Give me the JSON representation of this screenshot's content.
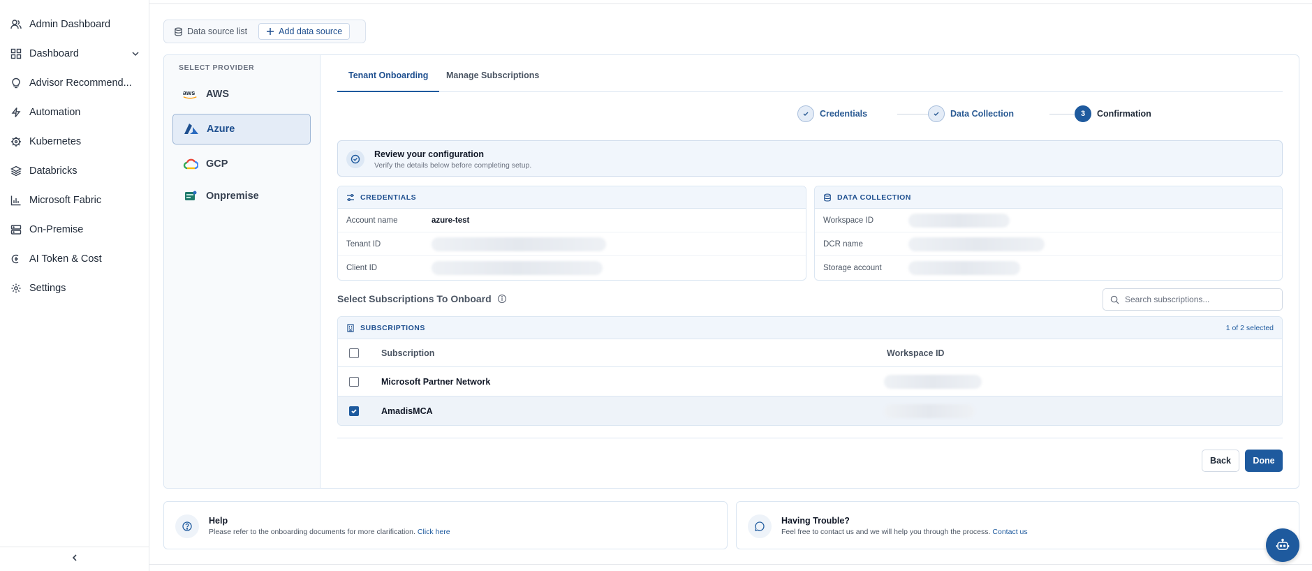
{
  "sidebar": {
    "items": [
      {
        "label": "Admin Dashboard",
        "icon": "user-icon"
      },
      {
        "label": "Dashboard",
        "icon": "grid-icon"
      },
      {
        "label": "Advisor Recommend...",
        "icon": "lightbulb-icon"
      },
      {
        "label": "Automation",
        "icon": "bolt-icon"
      },
      {
        "label": "Kubernetes",
        "icon": "helm-icon"
      },
      {
        "label": "Databricks",
        "icon": "layers-icon"
      },
      {
        "label": "Microsoft Fabric",
        "icon": "bar-chart-icon"
      },
      {
        "label": "On-Premise",
        "icon": "server-icon"
      },
      {
        "label": "AI Token & Cost",
        "icon": "token-icon"
      },
      {
        "label": "Settings",
        "icon": "gear-icon"
      }
    ]
  },
  "toggle": {
    "list_label": "Data source list",
    "add_label": "Add data source"
  },
  "providers": {
    "title": "SELECT PROVIDER",
    "items": [
      {
        "label": "AWS",
        "logo_text": "aws"
      },
      {
        "label": "Azure"
      },
      {
        "label": "GCP"
      },
      {
        "label": "Onpremise"
      }
    ],
    "active": "Azure"
  },
  "tabs": {
    "onboarding": "Tenant Onboarding",
    "manage": "Manage Subscriptions"
  },
  "stepper": {
    "step1": "Credentials",
    "step2": "Data Collection",
    "step3_num": "3",
    "step3": "Confirmation"
  },
  "review": {
    "title": "Review your configuration",
    "subtitle": "Verify the details below before completing setup."
  },
  "credentials": {
    "title": "CREDENTIALS",
    "account_label": "Account name",
    "account_value": "azure-test",
    "tenant_label": "Tenant ID",
    "client_label": "Client ID"
  },
  "data_collection": {
    "title": "DATA COLLECTION",
    "workspace_label": "Workspace ID",
    "dcr_label": "DCR name",
    "storage_label": "Storage account"
  },
  "subscriptions": {
    "section_title": "Select Subscriptions To Onboard",
    "search_placeholder": "Search subscriptions...",
    "table_title": "SUBSCRIPTIONS",
    "selected_count": "1 of 2 selected",
    "col_subscription": "Subscription",
    "col_workspace": "Workspace ID",
    "rows": [
      {
        "name": "Microsoft Partner Network",
        "checked": false
      },
      {
        "name": "AmadisMCA",
        "checked": true
      }
    ]
  },
  "actions": {
    "back": "Back",
    "done": "Done"
  },
  "help": {
    "title": "Help",
    "text": "Please refer to the onboarding documents for more clarification.",
    "link": "Click here"
  },
  "trouble": {
    "title": "Having Trouble?",
    "text": "Feel free to contact us and we will help you through the process.",
    "link": "Contact us"
  },
  "colors": {
    "accent": "#1e5a9e",
    "panel": "#f1f6fc",
    "border": "#dbe6f2"
  }
}
